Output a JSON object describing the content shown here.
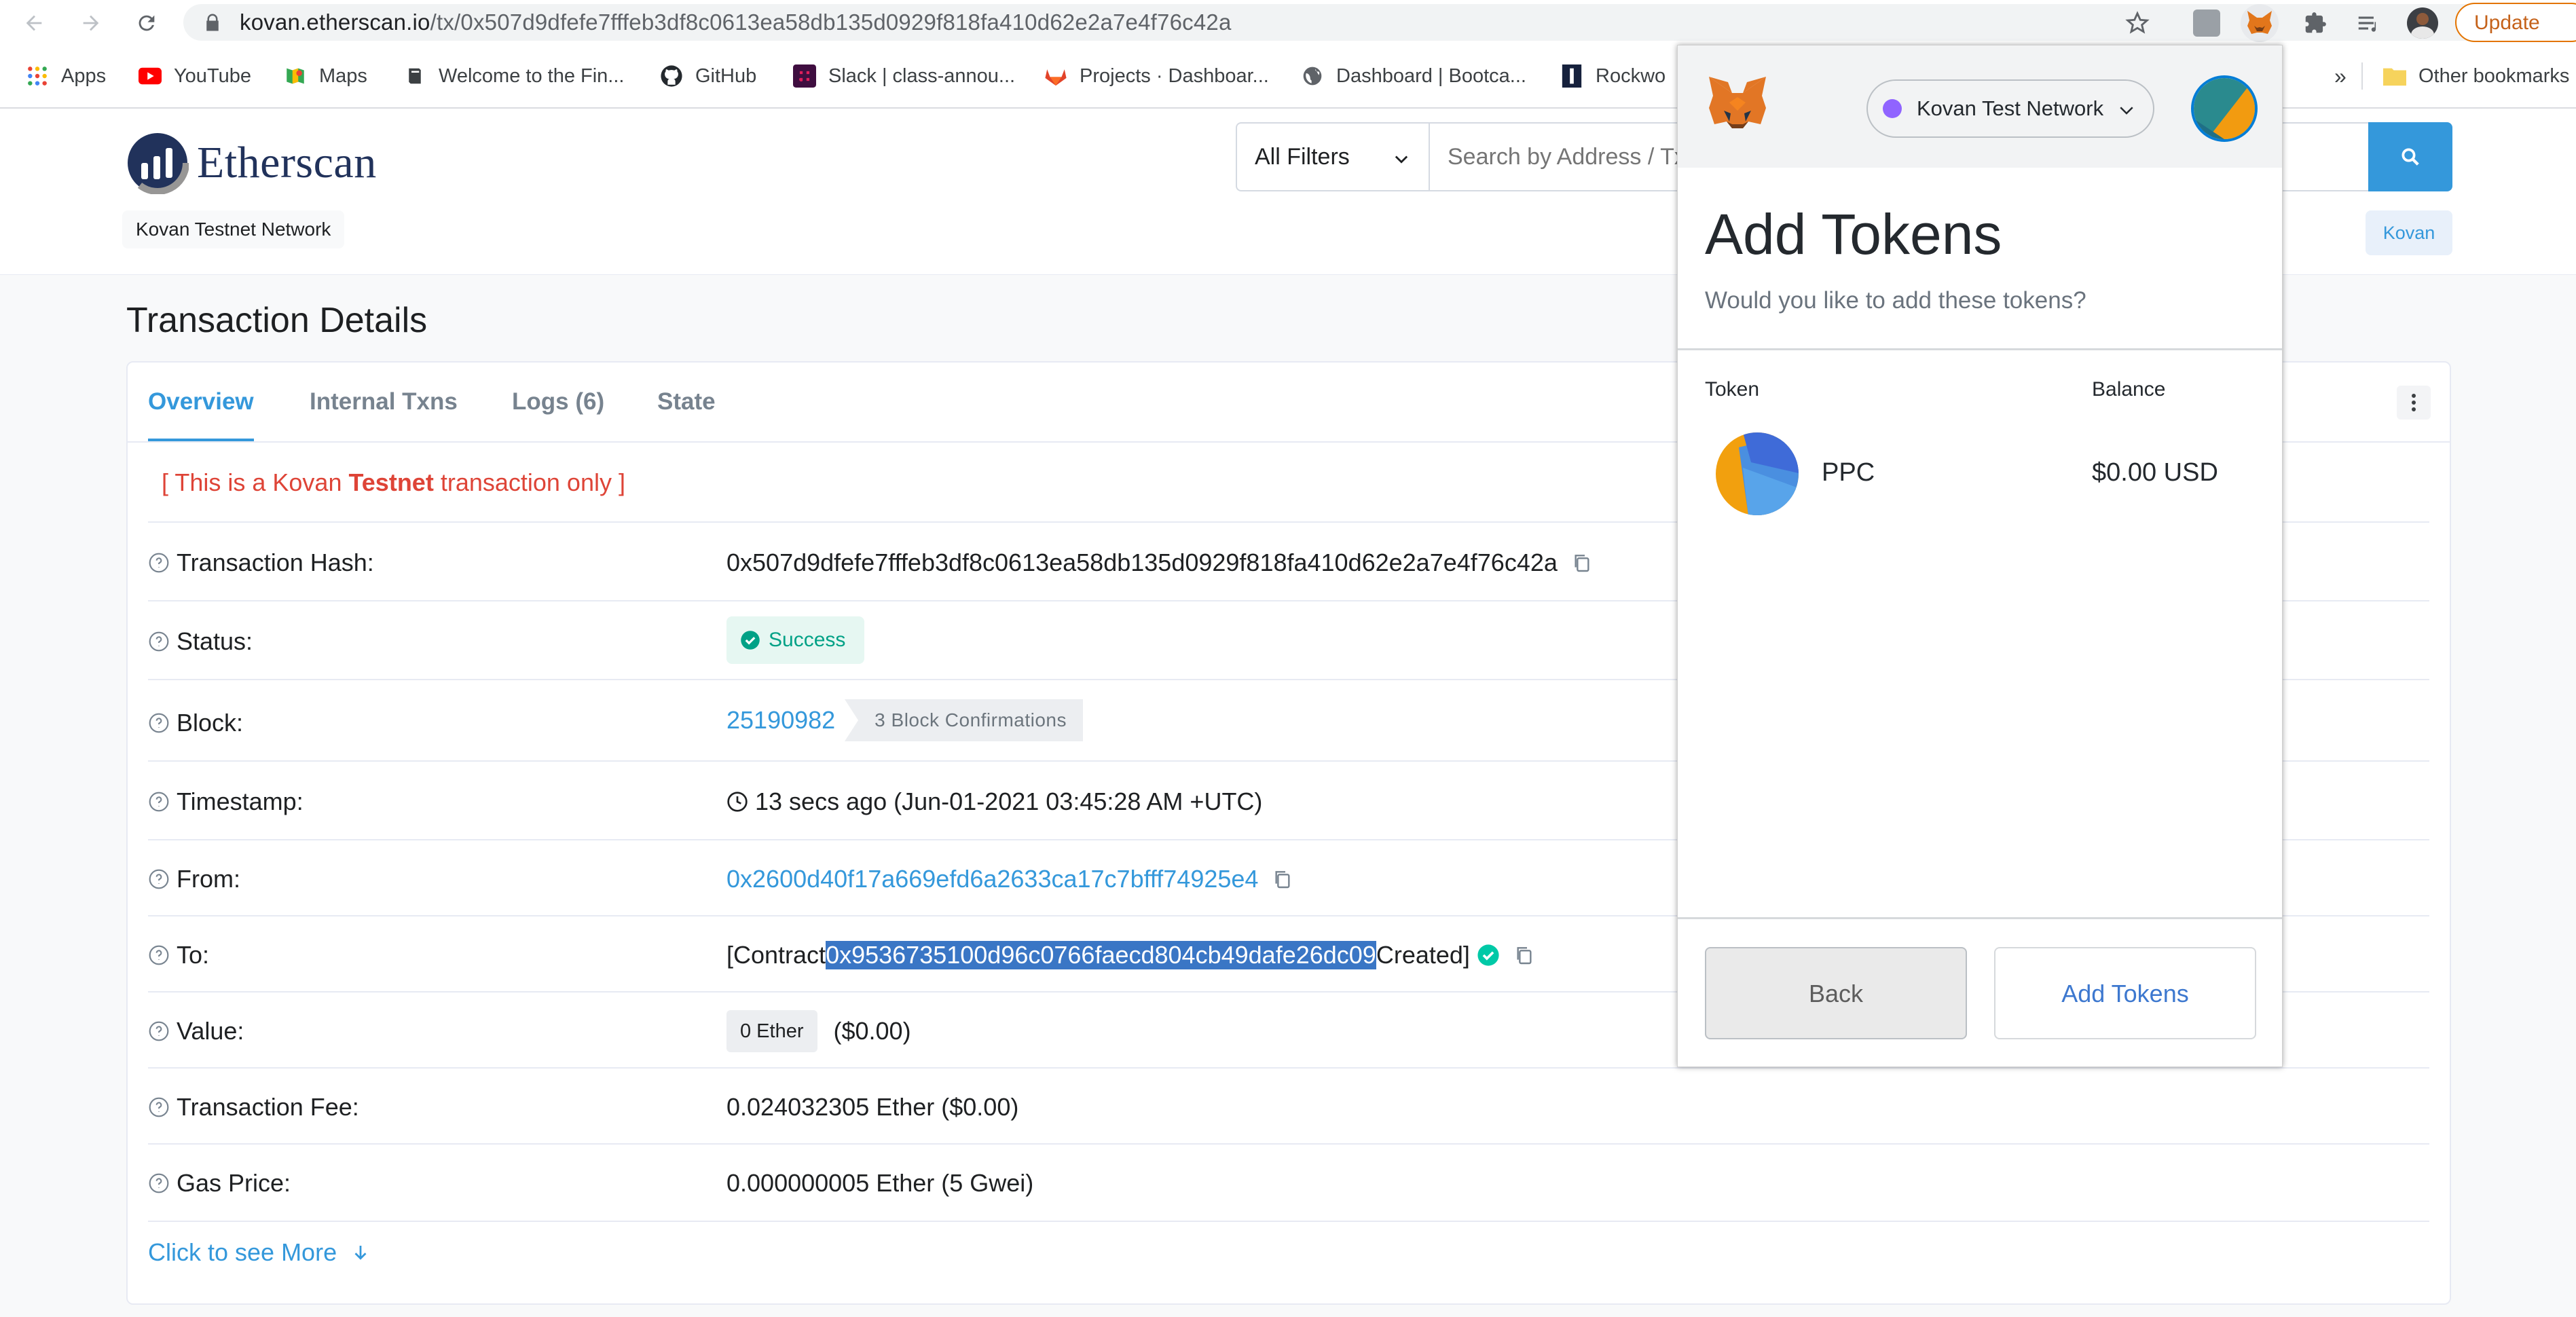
{
  "browser": {
    "url_host": "kovan.etherscan.io",
    "url_path": "/tx/0x507d9dfefe7fffeb3df8c0613ea58db135d0929f818fa410d62e2a7e4f76c42a",
    "update_label": "Update",
    "bookmarks": [
      {
        "label": "Apps",
        "icon": "apps-grid-icon"
      },
      {
        "label": "YouTube",
        "icon": "youtube-icon"
      },
      {
        "label": "Maps",
        "icon": "maps-icon"
      },
      {
        "label": "Welcome to the Fin...",
        "icon": "book-icon"
      },
      {
        "label": "GitHub",
        "icon": "github-icon"
      },
      {
        "label": "Slack | class-annou...",
        "icon": "slack-icon"
      },
      {
        "label": "Projects · Dashboar...",
        "icon": "gitlab-icon"
      },
      {
        "label": "Dashboard | Bootca...",
        "icon": "globe-icon"
      },
      {
        "label": "Rockwo",
        "icon": "rockwood-icon"
      }
    ],
    "bookmarks_overflow": "»",
    "other_bookmarks": "Other bookmarks"
  },
  "header": {
    "logo_text": "Etherscan",
    "network_tag": "Kovan Testnet Network",
    "filter_label": "All Filters",
    "search_placeholder": "Search by Address / Txn Hash / Block / Token / Ens",
    "network_button": "Kovan"
  },
  "page": {
    "title": "Transaction Details",
    "tabs": [
      "Overview",
      "Internal Txns",
      "Logs (6)",
      "State"
    ],
    "notice_prefix": "[ This is a Kovan ",
    "notice_bold": "Testnet",
    "notice_suffix": " transaction only ]",
    "see_more": "Click to see More"
  },
  "tx": {
    "hash_label": "Transaction Hash:",
    "hash": "0x507d9dfefe7fffeb3df8c0613ea58db135d0929f818fa410d62e2a7e4f76c42a",
    "status_label": "Status:",
    "status": "Success",
    "block_label": "Block:",
    "block": "25190982",
    "confirmations": "3 Block Confirmations",
    "timestamp_label": "Timestamp:",
    "timestamp": "13 secs ago (Jun-01-2021 03:45:28 AM +UTC)",
    "from_label": "From:",
    "from": "0x2600d40f17a669efd6a2633ca17c7bfff74925e4",
    "to_label": "To:",
    "to_prefix": "[Contract ",
    "to_address": "0x9536735100d96c0766faecd804cb49dafe26dc09",
    "to_suffix": " Created]",
    "value_label": "Value:",
    "value_ether": "0 Ether",
    "value_usd": "($0.00)",
    "fee_label": "Transaction Fee:",
    "fee": "0.024032305 Ether ($0.00)",
    "gas_label": "Gas Price:",
    "gas": "0.000000005 Ether (5 Gwei)"
  },
  "metamask": {
    "network": "Kovan Test Network",
    "title": "Add Tokens",
    "subtitle": "Would you like to add these tokens?",
    "col_token": "Token",
    "col_balance": "Balance",
    "token_symbol": "PPC",
    "token_balance": "$0.00 USD",
    "back_label": "Back",
    "add_label": "Add Tokens"
  },
  "colors": {
    "etherscan_blue": "#3498db",
    "testnet_red": "#de4437",
    "success_green": "#00a186",
    "metamask_network_dot": "#9064ff",
    "chrome_update_orange": "#e37400"
  }
}
